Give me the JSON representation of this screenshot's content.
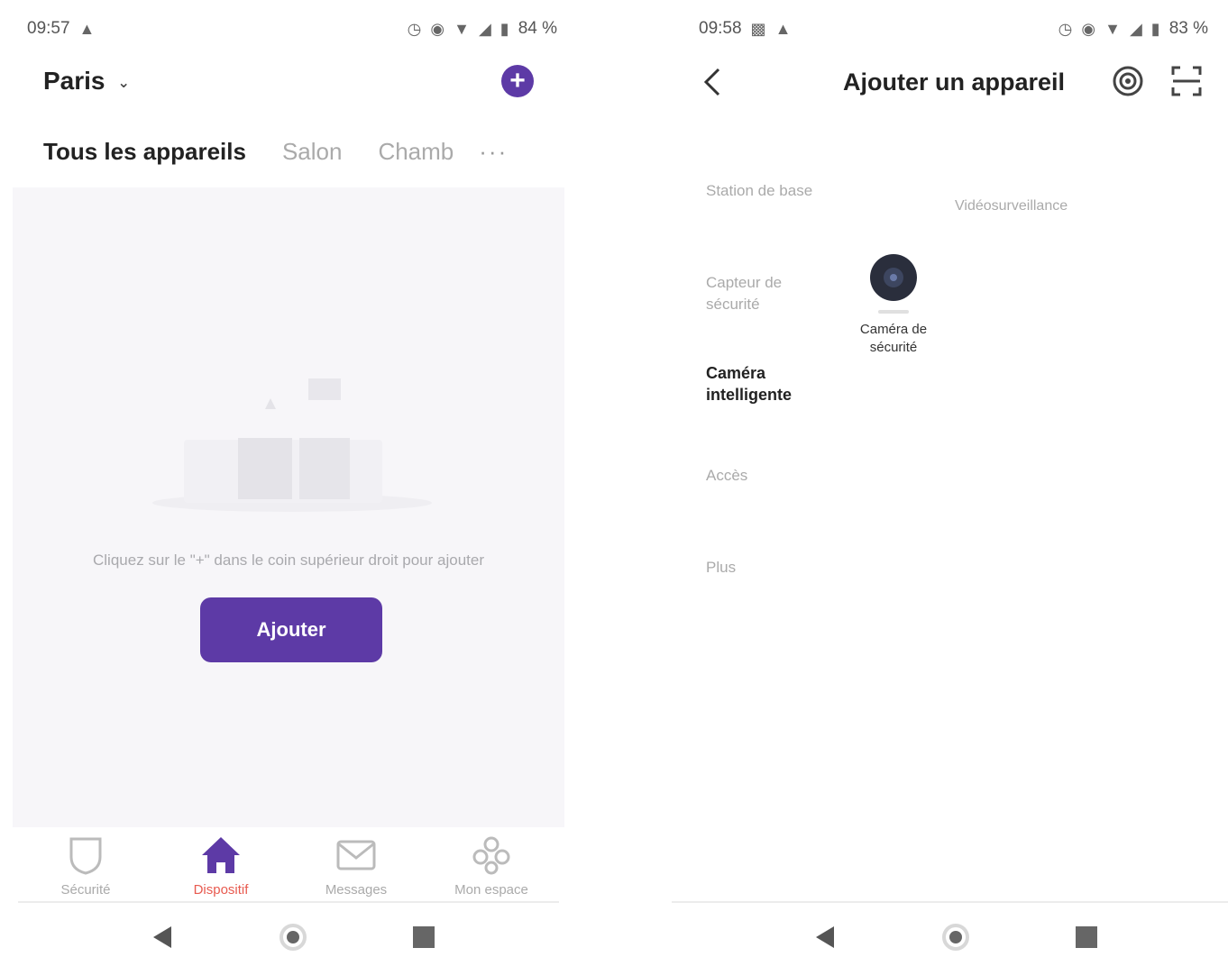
{
  "left": {
    "status": {
      "time": "09:57",
      "battery": "84 %"
    },
    "header": {
      "city": "Paris"
    },
    "tabs": [
      {
        "label": "Tous les appareils"
      },
      {
        "label": "Salon"
      },
      {
        "label": "Chamb"
      }
    ],
    "tab_more": "···",
    "empty": {
      "text": "Cliquez sur le \"+\" dans le coin supérieur droit pour ajouter",
      "button": "Ajouter"
    },
    "nav": [
      {
        "label": "Sécurité",
        "icon": "shield-icon"
      },
      {
        "label": "Dispositif",
        "icon": "home-icon"
      },
      {
        "label": "Messages",
        "icon": "mail-icon"
      },
      {
        "label": "Mon espace",
        "icon": "profile-icon"
      }
    ]
  },
  "right": {
    "status": {
      "time": "09:58",
      "battery": "83 %"
    },
    "header": {
      "title": "Ajouter un appareil"
    },
    "categories": [
      {
        "label": "Station de base"
      },
      {
        "label": "Capteur de sécurité"
      },
      {
        "label": "Caméra intelligente"
      },
      {
        "label": "Accès"
      },
      {
        "label": "Plus"
      }
    ],
    "subheader": "Vidéosurveillance",
    "device": {
      "label": "Caméra de sécurité"
    }
  },
  "colors": {
    "accent": "#5d3aa6",
    "active_nav": "#e85a4f"
  }
}
